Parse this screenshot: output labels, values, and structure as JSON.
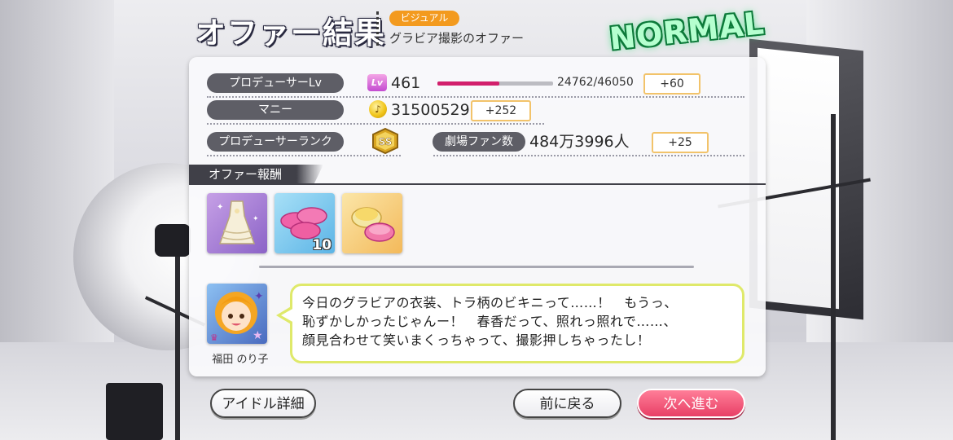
{
  "header": {
    "title": "オファー結果",
    "category_badge": "ビジュアル",
    "offer_name": "グラビア撮影のオファー",
    "difficulty": "NORMAL"
  },
  "stats": {
    "producer_lv_label": "プロデューサーLv",
    "lv_icon_text": "Lv",
    "level": "461",
    "exp_text": "24762/46050",
    "exp_current": 24762,
    "exp_max": 46050,
    "exp_gain": "+60",
    "money_label": "マニー",
    "money": "31500529",
    "money_gain": "+252",
    "rank_label": "プロデューサーランク",
    "rank_badge": "SS",
    "fans_label": "劇場ファン数",
    "fans": "484万3996人",
    "fans_gain": "+25"
  },
  "rewards": {
    "header": "オファー報酬",
    "items": [
      {
        "name": "costume-dress",
        "count": ""
      },
      {
        "name": "pink-candies",
        "count": "10"
      },
      {
        "name": "gift-box",
        "count": ""
      }
    ]
  },
  "idol": {
    "name": "福田 のり子",
    "dialogue_line1": "今日のグラビアの衣装、トラ柄のビキニって……！　もうっ、",
    "dialogue_line2": "恥ずかしかったじゃんー！　春香だって、照れっ照れで……、",
    "dialogue_line3": "顔見合わせて笑いまくっちゃって、撮影押しちゃったし！"
  },
  "buttons": {
    "idol_detail": "アイドル詳細",
    "back": "前に戻る",
    "next": "次へ進む"
  },
  "colors": {
    "exp_bar": "#d21f6c",
    "badge": "#f39a1e",
    "next_button": "#e83f66",
    "difficulty_glow": "#3de07f"
  }
}
